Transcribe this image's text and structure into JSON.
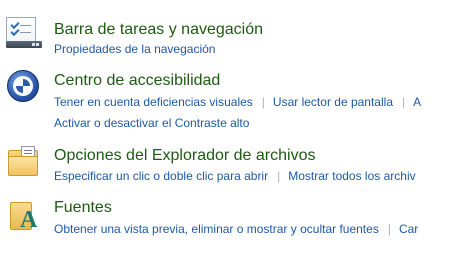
{
  "categories": [
    {
      "title": "Barra de tareas y navegación",
      "icon": "taskbar-navigation-icon",
      "links": [
        "Propiedades de la navegación"
      ]
    },
    {
      "title": "Centro de accesibilidad",
      "icon": "accessibility-center-icon",
      "links": [
        "Tener en cuenta deficiencias visuales",
        "Usar lector de pantalla",
        "A",
        "Activar o desactivar el Contraste alto"
      ]
    },
    {
      "title": "Opciones del Explorador de archivos",
      "icon": "folder-options-icon",
      "links": [
        "Especificar un clic o doble clic para abrir",
        "Mostrar todos los archiv"
      ]
    },
    {
      "title": "Fuentes",
      "icon": "fonts-folder-icon",
      "links": [
        "Obtener una vista previa, eliminar o mostrar y ocultar fuentes",
        "Car"
      ]
    }
  ],
  "colors": {
    "title": "#1e5a12",
    "link": "#1c5aa6",
    "separator": "#a8b4c4",
    "background": "#ffffff"
  }
}
